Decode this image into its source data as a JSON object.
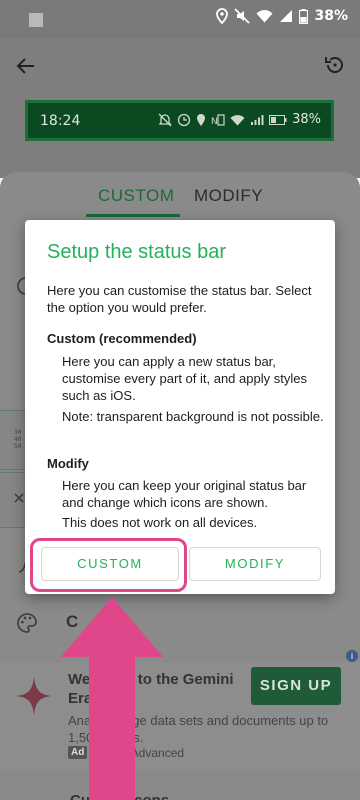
{
  "system_status": {
    "battery_text": "38%"
  },
  "preview": {
    "time": "18:24",
    "battery_text": "38%"
  },
  "tabs": [
    {
      "label": "CUSTOM",
      "selected": true
    },
    {
      "label": "MODIFY",
      "selected": false
    }
  ],
  "dialog": {
    "title": "Setup the status bar",
    "intro": "Here you can customise the status bar. Select the option you would prefer.",
    "custom_heading": "Custom (recommended)",
    "custom_desc": "Here you can apply a new status bar, customise every part of it, and apply styles such as iOS.",
    "custom_note": "Note: transparent background is not possible.",
    "modify_heading": "Modify",
    "modify_desc": "Here you can keep your original status bar and change which icons are shown.",
    "modify_note": "This does not work on all devices.",
    "custom_button": "CUSTOM",
    "modify_button": "MODIFY"
  },
  "background": {
    "partial_label": "C",
    "custom_icons_label": "Custom icons",
    "row_small_text": [
      "30",
      "40",
      "50"
    ]
  },
  "ad": {
    "title": "Welcome to the Gemini Era",
    "button": "SIGN UP",
    "description": "Analyze large data sets and documents up to 1,500 pages.",
    "badge": "Ad",
    "advertiser": "Gemini Advanced",
    "info_glyph": "i"
  },
  "colors": {
    "accent_green": "#22b259",
    "annotation_pink": "#e0468a",
    "preview_bar_bg": "#0b4a21"
  }
}
